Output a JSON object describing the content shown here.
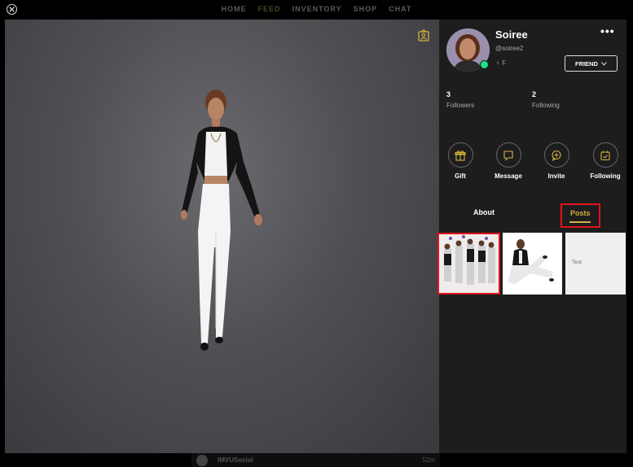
{
  "window": {
    "close_icon": "close-circle-icon"
  },
  "nav": {
    "items": [
      {
        "label": "HOME",
        "active": false
      },
      {
        "label": "FEED",
        "active": true
      },
      {
        "label": "INVENTORY",
        "active": false
      },
      {
        "label": "SHOP",
        "active": false
      },
      {
        "label": "CHAT",
        "active": false
      }
    ]
  },
  "viewport": {
    "icon": "picture-frame-icon"
  },
  "profile": {
    "name": "Soiree",
    "handle": "@soiree2",
    "gender": "F",
    "online": true,
    "more_label": "•••",
    "friend_button": "FRIEND",
    "followers_count": "3",
    "followers_label": "Followers",
    "following_count": "2",
    "following_label": "Following"
  },
  "actions": [
    {
      "label": "Gift",
      "icon": "gift-icon"
    },
    {
      "label": "Message",
      "icon": "speech-bubble-icon"
    },
    {
      "label": "Invite",
      "icon": "plus-bubble-icon"
    },
    {
      "label": "Following",
      "icon": "calendar-check-icon"
    }
  ],
  "tabs": {
    "about": "About",
    "posts": "Posts"
  },
  "posts": [
    {
      "type": "image",
      "caption": ""
    },
    {
      "type": "image",
      "caption": ""
    },
    {
      "type": "text",
      "caption": "Test"
    }
  ],
  "feed_preview": {
    "name": "IMVUSocial",
    "time": "52m"
  },
  "colors": {
    "accent": "#d4b13c",
    "highlight": "#e1141b",
    "online": "#1de08d"
  }
}
